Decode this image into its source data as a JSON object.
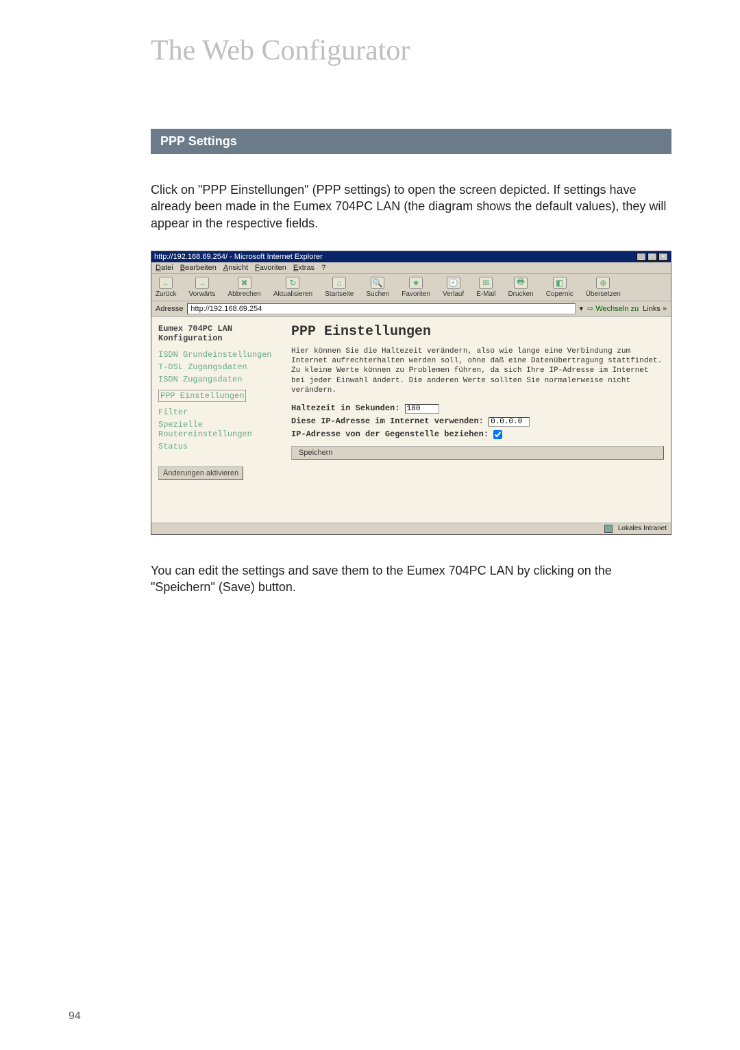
{
  "page": {
    "title": "The Web Configurator",
    "number": "94"
  },
  "section": {
    "heading": "PPP Settings",
    "intro": "Click on \"PPP Einstellungen\" (PPP settings) to open the screen depicted. If settings have already been made in the Eumex 704PC LAN (the diagram shows the default values), they will appear in the respective fields.",
    "outro": "You can edit the settings and save them to the Eumex 704PC LAN by clicking on the \"Speichern\" (Save) button."
  },
  "ie": {
    "title": "http://192.168.69.254/ - Microsoft Internet Explorer",
    "menus": [
      "Datei",
      "Bearbeiten",
      "Ansicht",
      "Favoriten",
      "Extras",
      "?"
    ],
    "toolbar": [
      {
        "name": "back",
        "label": "Zurück",
        "glyph": "←"
      },
      {
        "name": "forward",
        "label": "Vorwärts",
        "glyph": "→"
      },
      {
        "name": "stop",
        "label": "Abbrechen",
        "glyph": "✖"
      },
      {
        "name": "refresh",
        "label": "Aktualisieren",
        "glyph": "↻"
      },
      {
        "name": "home",
        "label": "Startseite",
        "glyph": "⌂"
      },
      {
        "name": "search",
        "label": "Suchen",
        "glyph": "🔍"
      },
      {
        "name": "favorites",
        "label": "Favoriten",
        "glyph": "★"
      },
      {
        "name": "history",
        "label": "Verlauf",
        "glyph": "🕘"
      },
      {
        "name": "mail",
        "label": "E-Mail",
        "glyph": "✉"
      },
      {
        "name": "print",
        "label": "Drucken",
        "glyph": "🖶"
      },
      {
        "name": "copernic",
        "label": "Copernic",
        "glyph": "◧"
      },
      {
        "name": "translate",
        "label": "Übersetzen",
        "glyph": "⊕"
      }
    ],
    "address": {
      "label": "Adresse",
      "value": "http://192.168.69.254",
      "go": "Wechseln zu",
      "links": "Links »"
    },
    "sidebar": {
      "header": "Eumex 704PC LAN\nKonfiguration",
      "items": [
        {
          "label": "ISDN Grundeinstellungen"
        },
        {
          "label": "T-DSL Zugangsdaten"
        },
        {
          "label": "ISDN Zugangsdaten"
        },
        {
          "label": "PPP Einstellungen",
          "boxed": true
        },
        {
          "label": "Filter"
        },
        {
          "label": "Spezielle Routereinstellungen"
        },
        {
          "label": "Status"
        }
      ],
      "activate": "Änderungen aktivieren"
    },
    "main": {
      "heading": "PPP Einstellungen",
      "description": "Hier können Sie die Haltezeit verändern, also wie lange eine Verbindung zum Internet aufrechterhalten werden soll, ohne daß eine Datenübertragung stattfindet. Zu kleine Werte können zu Problemen führen, da sich Ihre IP-Adresse im Internet bei jeder Einwahl ändert. Die anderen Werte sollten Sie normalerweise nicht verändern.",
      "rows": {
        "holdtime_label": "Haltezeit in Sekunden:",
        "holdtime_value": "180",
        "useip_label": "Diese IP-Adresse im Internet verwenden:",
        "useip_value": "0.0.0.0",
        "getip_label": "IP-Adresse von der Gegenstelle beziehen:"
      },
      "save": "Speichern"
    },
    "status": {
      "zone": "Lokales Intranet"
    }
  }
}
